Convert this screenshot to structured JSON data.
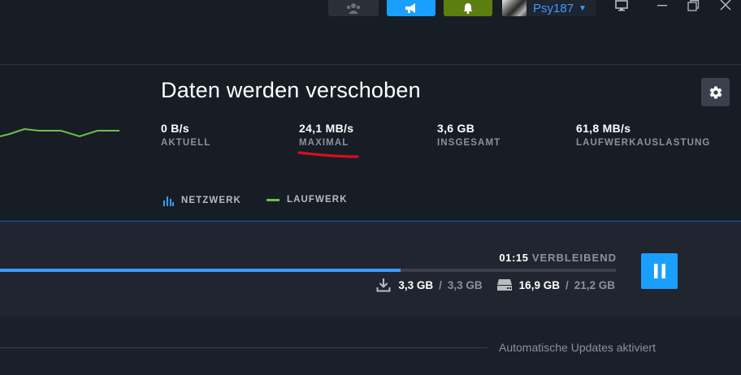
{
  "header": {
    "username": "Psy187",
    "buttons": {
      "friends_icon": "friends-icon",
      "announce_icon": "megaphone-icon",
      "notify_icon": "bell-icon"
    },
    "window_controls": [
      "monitor-icon",
      "minimize-icon",
      "maximize-icon",
      "close-icon"
    ]
  },
  "stats": {
    "title": "Daten werden verschoben",
    "items": [
      {
        "value": "0 B/s",
        "label": "AKTUELL"
      },
      {
        "value": "24,1 MB/s",
        "label": "MAXIMAL"
      },
      {
        "value": "3,6 GB",
        "label": "INSGESAMT"
      },
      {
        "value": "61,8 MB/s",
        "label": "LAUFWERKAUSLASTUNG"
      }
    ],
    "legend": {
      "network": "NETZWERK",
      "disk": "LAUFWERK"
    }
  },
  "download": {
    "time_remaining": "01:15",
    "remaining_label": "VERBLEIBEND",
    "progress": 0.65,
    "download_current": "3,3 GB",
    "download_total": "3,3 GB",
    "disk_current": "16,9 GB",
    "disk_total": "21,2 GB",
    "separator": "/"
  },
  "footer": {
    "auto_updates": "Automatische Updates aktiviert"
  },
  "colors": {
    "accent_blue": "#1a9fff",
    "graph_green": "#6dbf4b",
    "annotation_red": "#d6101a"
  }
}
